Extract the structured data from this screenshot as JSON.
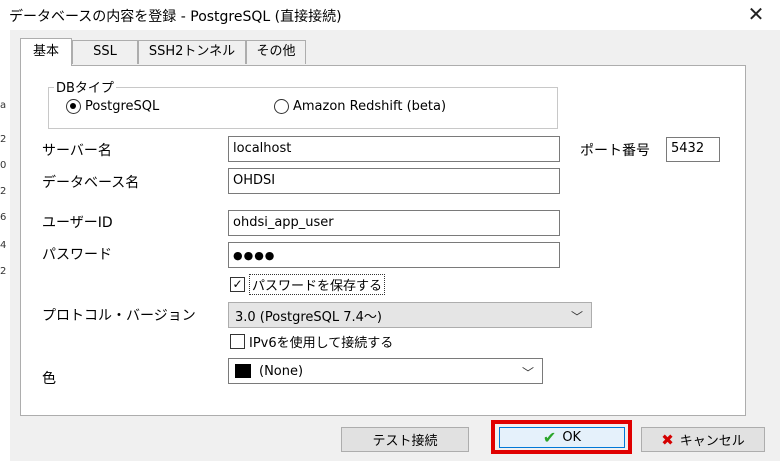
{
  "window": {
    "title": "データベースの内容を登録 - PostgreSQL (直接接続)",
    "close_glyph": "✕"
  },
  "tabs": [
    {
      "label": "基本",
      "active": true
    },
    {
      "label": "SSL",
      "active": false
    },
    {
      "label": "SSH2トンネル",
      "active": false
    },
    {
      "label": "その他",
      "active": false
    }
  ],
  "db_type": {
    "legend": "DBタイプ",
    "options": [
      {
        "label": "PostgreSQL",
        "selected": true
      },
      {
        "label": "Amazon Redshift (beta)",
        "selected": false
      }
    ]
  },
  "form": {
    "server_label": "サーバー名",
    "server_value": "localhost",
    "port_label": "ポート番号",
    "port_value": "5432",
    "database_label": "データベース名",
    "database_value": "OHDSI",
    "user_label": "ユーザーID",
    "user_value": "ohdsi_app_user",
    "password_label": "パスワード",
    "password_value": "●●●●",
    "save_password_label": "パスワードを保存する",
    "save_password_checked": true,
    "protocol_label": "プロトコル・バージョン",
    "protocol_value": "3.0  (PostgreSQL 7.4～)",
    "ipv6_label": "IPv6を使用して接続する",
    "ipv6_checked": false,
    "color_label": "色",
    "color_value": "(None)",
    "color_swatch": "#000000"
  },
  "buttons": {
    "test_label": "テスト接続",
    "ok_label": "OK",
    "cancel_label": "キャンセル"
  },
  "left_strip_chars": [
    "a",
    "2",
    "0",
    "2",
    "6",
    "4",
    "2"
  ],
  "colors": {
    "highlight_outline": "#e00000",
    "ok_border": "#0078d7",
    "check_green": "#2aa52a",
    "cancel_red": "#d40000"
  }
}
